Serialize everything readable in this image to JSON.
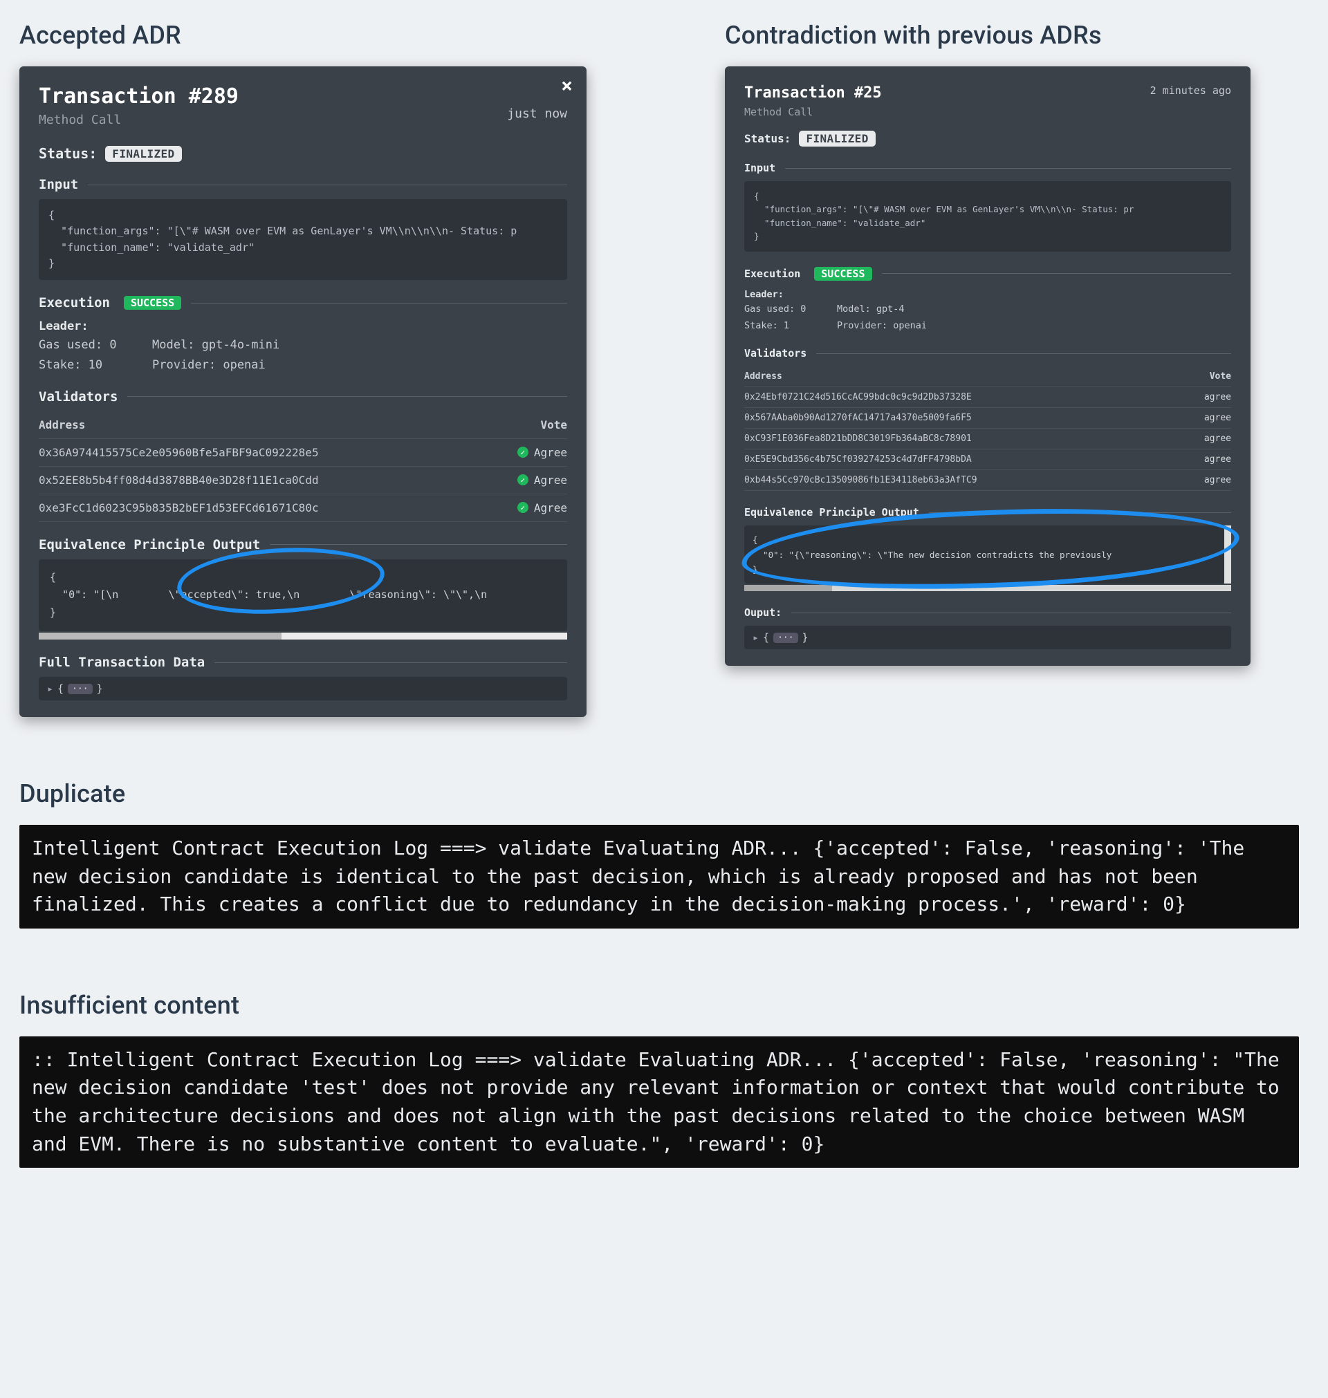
{
  "section_titles": {
    "accepted": "Accepted ADR",
    "contradiction": "Contradiction with previous ADRs",
    "duplicate": "Duplicate",
    "insufficient": "Insufficient content"
  },
  "tx_left": {
    "title": "Transaction #289",
    "subtitle": "Method Call",
    "timestamp": "just now",
    "status_label": "Status:",
    "status_badge": "FINALIZED",
    "input_head": "Input",
    "input_code": "{\n  \"function_args\": \"[\\\"# WASM over EVM as GenLayer's VM\\\\n\\\\n\\\\n- Status: p\n  \"function_name\": \"validate_adr\"\n}",
    "execution_head": "Execution",
    "execution_badge": "SUCCESS",
    "leader_head": "Leader:",
    "gas_label": "Gas used: 0",
    "model_label": "Model: gpt-4o-mini",
    "stake_label": "Stake: 10",
    "provider_label": "Provider: openai",
    "validators_head": "Validators",
    "val_col_addr": "Address",
    "val_col_vote": "Vote",
    "validators": [
      {
        "address": "0x36A974415575Ce2e05960Bfe5aFBF9aC092228e5",
        "vote": "Agree"
      },
      {
        "address": "0x52EE8b5b4ff08d4d3878BB40e3D28f11E1ca0Cdd",
        "vote": "Agree"
      },
      {
        "address": "0xe3FcC1d6023C95b835B2bEF1d53EFCd61671C80c",
        "vote": "Agree"
      }
    ],
    "ep_head": "Equivalence Principle Output",
    "ep_code": "{\n  \"0\": \"[\\n        \\\"accepted\\\": true,\\n        \\\"reasoning\\\": \\\"\\\",\\n\n}",
    "ftd_head": "Full Transaction Data",
    "ftd_code": "▸ { ··· }"
  },
  "tx_right": {
    "title": "Transaction #25",
    "subtitle": "Method Call",
    "timestamp": "2 minutes ago",
    "status_label": "Status:",
    "status_badge": "FINALIZED",
    "input_head": "Input",
    "input_code": "{\n  \"function_args\": \"[\\\"# WASM over EVM as GenLayer's VM\\\\n\\\\n- Status: pr\n  \"function_name\": \"validate_adr\"\n}",
    "execution_head": "Execution",
    "execution_badge": "SUCCESS",
    "leader_head": "Leader:",
    "gas_label": "Gas used: 0",
    "model_label": "Model: gpt-4",
    "stake_label": "Stake: 1",
    "provider_label": "Provider: openai",
    "validators_head": "Validators",
    "val_col_addr": "Address",
    "val_col_vote": "Vote",
    "validators": [
      {
        "address": "0x24Ebf0721C24d516CcAC99bdc0c9c9d2Db37328E",
        "vote": "agree"
      },
      {
        "address": "0x567AAba0b90Ad1270fAC14717a4370e5009fa6F5",
        "vote": "agree"
      },
      {
        "address": "0xC93F1E036Fea8D21bDD8C3019Fb364aBC8c78901",
        "vote": "agree"
      },
      {
        "address": "0xE5E9Cbd356c4b75Cf039274253c4d7dFF4798bDA",
        "vote": "agree"
      },
      {
        "address": "0xb44s5Cc970cBc13509086fb1E34118eb63a3AfTC9",
        "vote": "agree"
      }
    ],
    "ep_head": "Equivalence Principle Output",
    "ep_code": "{\n  \"0\": \"{\\\"reasoning\\\": \\\"The new decision contradicts the previously\n}",
    "output_head": "Ouput:",
    "output_code": "▸ { ··· }"
  },
  "console_duplicate": "Intelligent Contract Execution Log ===> validate Evaluating ADR... {'accepted': False, 'reasoning': 'The new decision candidate is identical to the past decision, which is already proposed and has not been finalized. This creates a conflict due to redundancy in the decision-making process.', 'reward': 0}",
  "console_insufficient": ":: Intelligent Contract Execution Log ===> validate Evaluating ADR... {'accepted': False, 'reasoning': \"The new decision candidate 'test' does not provide any relevant information or context that would contribute to the architecture decisions and does not align with the past decisions related to the choice between WASM and EVM. There is no substantive content to evaluate.\", 'reward': 0}"
}
